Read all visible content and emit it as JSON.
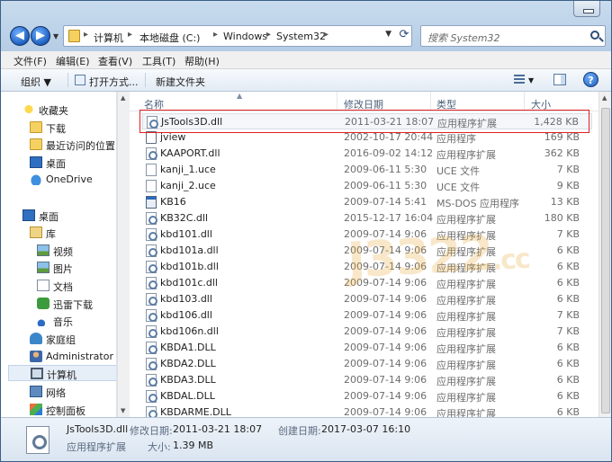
{
  "address": {
    "crumbs": [
      "计算机",
      "本地磁盘 (C:)",
      "Windows",
      "System32"
    ]
  },
  "search": {
    "placeholder": "搜索 System32"
  },
  "menu": [
    "文件(F)",
    "编辑(E)",
    "查看(V)",
    "工具(T)",
    "帮助(H)"
  ],
  "toolbar": {
    "organize": "组织 ▼",
    "open_with": "打开方式...",
    "new_folder": "新建文件夹"
  },
  "nav": {
    "favorites": "收藏夹",
    "downloads": "下载",
    "recent": "最近访问的位置",
    "desktop_fav": "桌面",
    "onedrive": "OneDrive",
    "desktop": "桌面",
    "library": "库",
    "videos": "视频",
    "pictures": "图片",
    "documents": "文档",
    "xunlei": "迅雷下载",
    "music": "音乐",
    "homegroup": "家庭组",
    "admin": "Administrator",
    "computer": "计算机",
    "network": "网络",
    "control_panel": "控制面板"
  },
  "columns": {
    "name": "名称",
    "modified": "修改日期",
    "type": "类型",
    "size": "大小"
  },
  "files": [
    {
      "name": "JsTools3D.dll",
      "date": "2011-03-21 18:07",
      "type": "应用程序扩展",
      "size": "1,428 KB",
      "icon": "dll-icon"
    },
    {
      "name": "jview",
      "date": "2002-10-17 20:44",
      "type": "应用程序",
      "size": "169 KB",
      "icon": "app-icon"
    },
    {
      "name": "KAAPORT.dll",
      "date": "2016-09-02 14:12",
      "type": "应用程序扩展",
      "size": "362 KB",
      "icon": "dll-icon"
    },
    {
      "name": "kanji_1.uce",
      "date": "2009-06-11 5:30",
      "type": "UCE 文件",
      "size": "7 KB",
      "icon": "file-icon"
    },
    {
      "name": "kanji_2.uce",
      "date": "2009-06-11 5:30",
      "type": "UCE 文件",
      "size": "9 KB",
      "icon": "file-icon"
    },
    {
      "name": "KB16",
      "date": "2009-07-14 5:41",
      "type": "MS-DOS 应用程序",
      "size": "13 KB",
      "icon": "exe-icon"
    },
    {
      "name": "KB32C.dll",
      "date": "2015-12-17 16:04",
      "type": "应用程序扩展",
      "size": "180 KB",
      "icon": "dll-icon"
    },
    {
      "name": "kbd101.dll",
      "date": "2009-07-14 9:06",
      "type": "应用程序扩展",
      "size": "7 KB",
      "icon": "dll-icon"
    },
    {
      "name": "kbd101a.dll",
      "date": "2009-07-14 9:06",
      "type": "应用程序扩展",
      "size": "6 KB",
      "icon": "dll-icon"
    },
    {
      "name": "kbd101b.dll",
      "date": "2009-07-14 9:06",
      "type": "应用程序扩展",
      "size": "6 KB",
      "icon": "dll-icon"
    },
    {
      "name": "kbd101c.dll",
      "date": "2009-07-14 9:06",
      "type": "应用程序扩展",
      "size": "6 KB",
      "icon": "dll-icon"
    },
    {
      "name": "kbd103.dll",
      "date": "2009-07-14 9:06",
      "type": "应用程序扩展",
      "size": "6 KB",
      "icon": "dll-icon"
    },
    {
      "name": "kbd106.dll",
      "date": "2009-07-14 9:06",
      "type": "应用程序扩展",
      "size": "7 KB",
      "icon": "dll-icon"
    },
    {
      "name": "kbd106n.dll",
      "date": "2009-07-14 9:06",
      "type": "应用程序扩展",
      "size": "7 KB",
      "icon": "dll-icon"
    },
    {
      "name": "KBDA1.DLL",
      "date": "2009-07-14 9:06",
      "type": "应用程序扩展",
      "size": "6 KB",
      "icon": "dll-icon"
    },
    {
      "name": "KBDA2.DLL",
      "date": "2009-07-14 9:06",
      "type": "应用程序扩展",
      "size": "6 KB",
      "icon": "dll-icon"
    },
    {
      "name": "KBDA3.DLL",
      "date": "2009-07-14 9:06",
      "type": "应用程序扩展",
      "size": "6 KB",
      "icon": "dll-icon"
    },
    {
      "name": "KBDAL.DLL",
      "date": "2009-07-14 9:06",
      "type": "应用程序扩展",
      "size": "6 KB",
      "icon": "dll-icon"
    },
    {
      "name": "KBDARME.DLL",
      "date": "2009-07-14 9:06",
      "type": "应用程序扩展",
      "size": "6 KB",
      "icon": "dll-icon"
    }
  ],
  "details": {
    "name": "JsTools3D.dll",
    "modified_label": "修改日期:",
    "modified": "2011-03-21 18:07",
    "created_label": "创建日期:",
    "created": "2017-03-07 16:10",
    "type": "应用程序扩展",
    "size_label": "大小:",
    "size": "1.39 MB"
  },
  "watermark": {
    "main": "J3322",
    "suffix": ".cc"
  },
  "colors": {
    "highlight_box": "#e02020",
    "accent": "#1e5fbf"
  }
}
